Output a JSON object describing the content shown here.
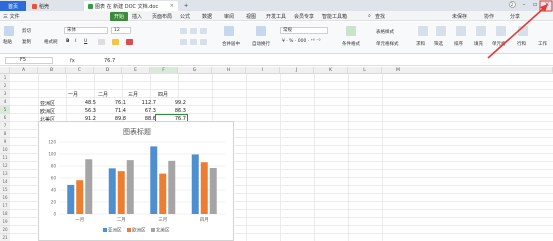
{
  "titlebar": {
    "home_tab": "首页",
    "shell_tab": "稻壳",
    "doc_tab": "图表 在 新建 DOC 文档.doc",
    "new_tab": "+",
    "badge": "2",
    "icons": [
      "page-icon",
      "minimize-icon",
      "maximize-icon",
      "close-icon"
    ]
  },
  "menubar": {
    "file": "三 文件",
    "items": [
      "开始",
      "插入",
      "页面布局",
      "公式",
      "数据",
      "审阅",
      "视图",
      "开发工具",
      "会员专享",
      "智能工具箱"
    ],
    "active": "开始",
    "search": "查找",
    "right": [
      "未保存",
      "协作",
      "分享"
    ]
  },
  "ribbon": {
    "paste": "粘贴",
    "cut": "剪切",
    "copy": "复制",
    "format_painter": "格式刷",
    "font": "宋体",
    "font_size": "12",
    "bold": "B",
    "italic": "I",
    "underline": "U",
    "merge": "合并居中",
    "wrap": "自动换行",
    "number_format": "常规",
    "conditional": "条件格式",
    "table_style": "表格样式",
    "cell_style": "单元格样式",
    "sum": "求和",
    "filter": "筛选",
    "sort": "排序",
    "fill": "填充",
    "cell": "单元格",
    "rowcol": "行和",
    "work": "工作"
  },
  "formula_bar": {
    "name_box": "F5",
    "fx": "fx",
    "value": "76.7"
  },
  "grid": {
    "columns": [
      "A",
      "B",
      "C",
      "D",
      "E",
      "F",
      "G",
      "H",
      "I",
      "J",
      "K",
      "L",
      "M"
    ],
    "selected_column": "F",
    "rows": [
      "1",
      "2",
      "3",
      "4",
      "5",
      "6",
      "7",
      "8",
      "9",
      "10",
      "11",
      "12",
      "13",
      "14",
      "15",
      "16",
      "17",
      "18",
      "19",
      "20",
      "21",
      "22"
    ],
    "selected_row": "5",
    "headers": [
      "一月",
      "二月",
      "三月",
      "四月"
    ],
    "row_labels": [
      "亚洲区",
      "欧洲区",
      "北美区"
    ],
    "values": [
      [
        "48.5",
        "76.1",
        "112.7",
        "99.2"
      ],
      [
        "56.3",
        "71.4",
        "67.3",
        "86.3"
      ],
      [
        "91.2",
        "89.8",
        "88.6",
        "76.7"
      ]
    ]
  },
  "colors": {
    "accent": "#3c8b3c",
    "home_tab": "#2b6cd8",
    "series": [
      "#4e8fd0",
      "#ed7d31",
      "#a5a5a5"
    ],
    "annotation": "#e53935"
  },
  "chart_data": {
    "type": "bar",
    "title": "图表标题",
    "categories": [
      "一月",
      "二月",
      "三月",
      "四月"
    ],
    "series": [
      {
        "name": "亚洲区",
        "values": [
          48.5,
          76.1,
          112.7,
          99.2
        ]
      },
      {
        "name": "欧洲区",
        "values": [
          56.3,
          71.4,
          67.3,
          86.3
        ]
      },
      {
        "name": "北美区",
        "values": [
          91.2,
          89.8,
          88.6,
          76.7
        ]
      }
    ],
    "ylim": [
      0,
      120
    ],
    "yticks": [
      "0",
      "20",
      "40",
      "60",
      "80",
      "100",
      "120"
    ],
    "grid": true,
    "legend_position": "bottom"
  }
}
